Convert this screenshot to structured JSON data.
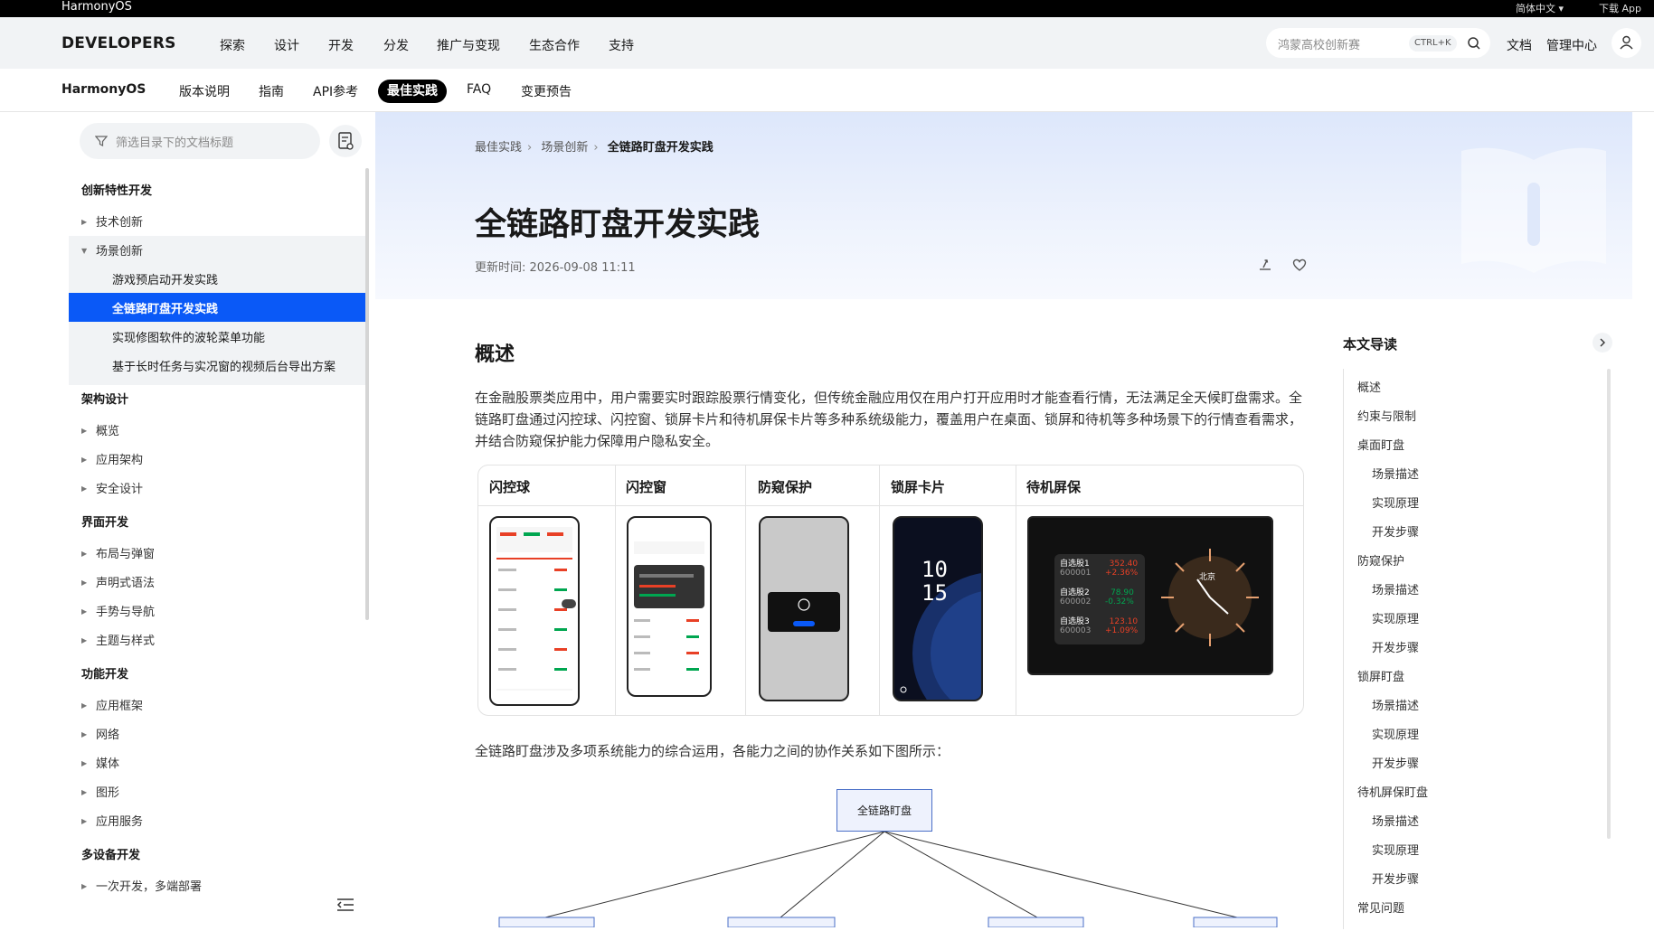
{
  "topbar": {
    "brand": "HarmonyOS",
    "language": "简体中文",
    "download": "下载 App"
  },
  "mainnav": {
    "logo": "DEVELOPERS",
    "items": [
      "探索",
      "设计",
      "开发",
      "分发",
      "推广与变现",
      "生态合作",
      "支持"
    ],
    "search_placeholder": "鸿蒙高校创新赛",
    "search_shortcut": "CTRL+K",
    "docs": "文档",
    "console": "管理中心"
  },
  "subnav": {
    "title": "HarmonyOS",
    "items": [
      "版本说明",
      "指南",
      "API参考",
      "最佳实践",
      "FAQ",
      "变更预告"
    ],
    "active": "最佳实践"
  },
  "sidebar": {
    "filter_placeholder": "筛选目录下的文档标题",
    "sections": [
      {
        "title": "创新特性开发",
        "children": [
          "技术创新",
          "场景创新"
        ]
      },
      {
        "title": "架构设计",
        "children": [
          "概览",
          "应用架构",
          "安全设计"
        ]
      },
      {
        "title": "界面开发",
        "children": [
          "布局与弹窗",
          "声明式语法",
          "手势与导航",
          "主题与样式"
        ]
      },
      {
        "title": "功能开发",
        "children": [
          "应用框架",
          "网络",
          "媒体",
          "图形",
          "应用服务"
        ]
      },
      {
        "title": "多设备开发",
        "children": [
          "一次开发，多端部署"
        ]
      }
    ],
    "expanded_items": [
      "游戏预启动开发实践",
      "全链路盯盘开发实践",
      "实现修图软件的波轮菜单功能",
      "基于长时任务与实况窗的视频后台导出方案"
    ],
    "selected": "全链路盯盘开发实践"
  },
  "article": {
    "breadcrumb": [
      "最佳实践",
      "场景创新",
      "全链路盯盘开发实践"
    ],
    "title": "全链路盯盘开发实践",
    "updated": "更新时间: 2026-09-08 11:11",
    "overview_heading": "概述",
    "overview_text": "在金融股票类应用中，用户需要实时跟踪股票行情变化，但传统金融应用仅在用户打开应用时才能查看行情，无法满足全天候盯盘需求。全链路盯盘通过闪控球、闪控窗、锁屏卡片和待机屏保卡片等多种系统级能力，覆盖用户在桌面、锁屏和待机等多种场景下的行情查看需求，并结合防窥保护能力保障用户隐私安全。",
    "figure_columns": [
      "闪控球",
      "闪控窗",
      "防窥保护",
      "锁屏卡片",
      "待机屏保"
    ],
    "lockscreen_time": [
      "10",
      "15"
    ],
    "standby": {
      "stocks": [
        {
          "name": "自选股1",
          "code": "600001",
          "price": "352.40",
          "change": "+2.36%"
        },
        {
          "name": "自选股2",
          "code": "600002",
          "price": "78.90",
          "change": "-0.32%"
        },
        {
          "name": "自选股3",
          "code": "600003",
          "price": "123.10",
          "change": "+1.09%"
        }
      ],
      "clock_city": "北京"
    },
    "relation_text": "全链路盯盘涉及多项系统能力的综合运用，各能力之间的协作关系如下图所示：",
    "diagram_root": "全链路盯盘"
  },
  "toc": {
    "title": "本文导读",
    "items": [
      {
        "label": "概述",
        "level": 1
      },
      {
        "label": "约束与限制",
        "level": 1
      },
      {
        "label": "桌面盯盘",
        "level": 1
      },
      {
        "label": "场景描述",
        "level": 2
      },
      {
        "label": "实现原理",
        "level": 2
      },
      {
        "label": "开发步骤",
        "level": 2
      },
      {
        "label": "防窥保护",
        "level": 1
      },
      {
        "label": "场景描述",
        "level": 2
      },
      {
        "label": "实现原理",
        "level": 2
      },
      {
        "label": "开发步骤",
        "level": 2
      },
      {
        "label": "锁屏盯盘",
        "level": 1
      },
      {
        "label": "场景描述",
        "level": 2
      },
      {
        "label": "实现原理",
        "level": 2
      },
      {
        "label": "开发步骤",
        "level": 2
      },
      {
        "label": "待机屏保盯盘",
        "level": 1
      },
      {
        "label": "场景描述",
        "level": 2
      },
      {
        "label": "实现原理",
        "level": 2
      },
      {
        "label": "开发步骤",
        "level": 2
      },
      {
        "label": "常见问题",
        "level": 1
      }
    ]
  },
  "colors": {
    "accent": "#0a59f7",
    "up": "#e84026",
    "down": "#00a650"
  }
}
